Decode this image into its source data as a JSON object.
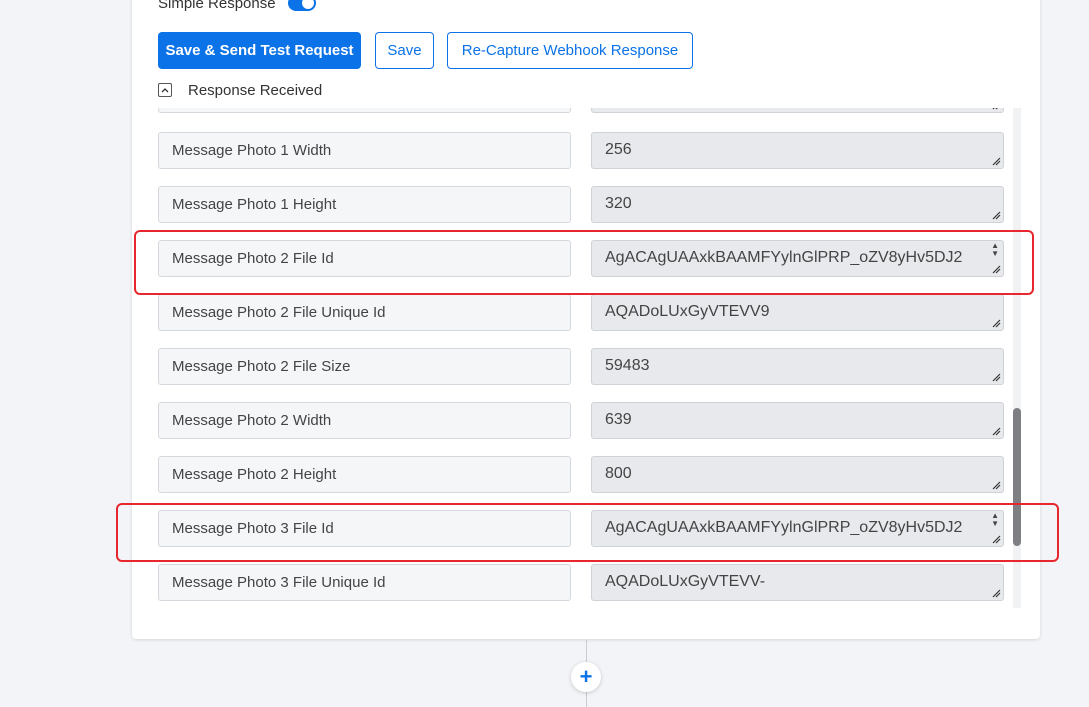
{
  "toggle": {
    "label": "Simple Response",
    "on": true
  },
  "buttons": {
    "save_send": "Save & Send Test Request",
    "save": "Save",
    "recapture": "Re-Capture Webhook Response"
  },
  "section": {
    "label": "Response Received",
    "collapse_glyph": "^"
  },
  "rows": [
    {
      "key": "",
      "value": ""
    },
    {
      "key": "Message Photo 1 Width",
      "value": "256"
    },
    {
      "key": "Message Photo 1 Height",
      "value": "320"
    },
    {
      "key": "Message Photo 2 File Id",
      "value": "AgACAgUAAxkBAAMFYylnGlPRP_oZV8yHv5DJ2",
      "highlighted": true
    },
    {
      "key": "Message Photo 2 File Unique Id",
      "value": "AQADoLUxGyVTEVV9"
    },
    {
      "key": "Message Photo 2 File Size",
      "value": "59483"
    },
    {
      "key": "Message Photo 2 Width",
      "value": "639"
    },
    {
      "key": "Message Photo 2 Height",
      "value": "800"
    },
    {
      "key": "Message Photo 3 File Id",
      "value": "AgACAgUAAxkBAAMFYylnGlPRP_oZV8yHv5DJ2",
      "highlighted": true
    },
    {
      "key": "Message Photo 3 File Unique Id",
      "value": "AQADoLUxGyVTEVV-"
    }
  ],
  "add_step": {
    "glyph": "+"
  },
  "colors": {
    "accent": "#0b72e7",
    "highlight": "#e8262d"
  }
}
